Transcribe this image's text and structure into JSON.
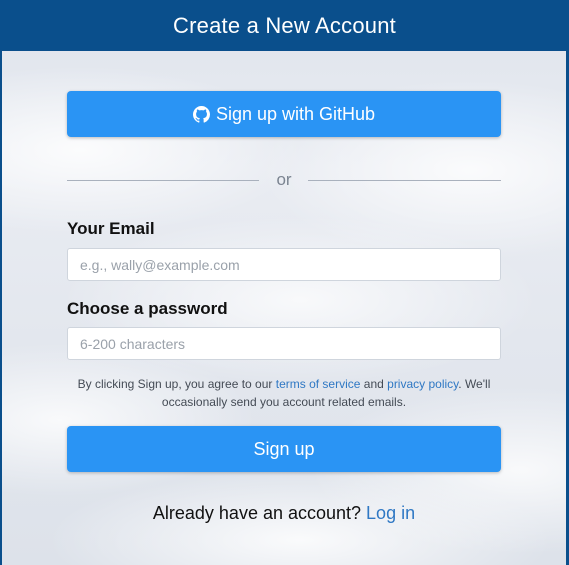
{
  "header": {
    "title": "Create a New Account"
  },
  "github_button": {
    "icon": "github-icon",
    "label": "Sign up with GitHub"
  },
  "divider": {
    "text": "or"
  },
  "email": {
    "label": "Your Email",
    "placeholder": "e.g., wally@example.com",
    "value": ""
  },
  "password": {
    "label": "Choose a password",
    "placeholder": "6-200 characters",
    "value": ""
  },
  "terms": {
    "prefix": "By clicking Sign up, you agree to our ",
    "terms_link": "terms of service",
    "middle": " and ",
    "privacy_link": "privacy policy",
    "suffix": ". We'll occasionally send you account related emails."
  },
  "signup_button": {
    "label": "Sign up"
  },
  "login": {
    "prompt": "Already have an account? ",
    "link": "Log in"
  },
  "colors": {
    "header": "#0a4f8c",
    "button": "#2a94f4",
    "link": "#2f78c4"
  }
}
